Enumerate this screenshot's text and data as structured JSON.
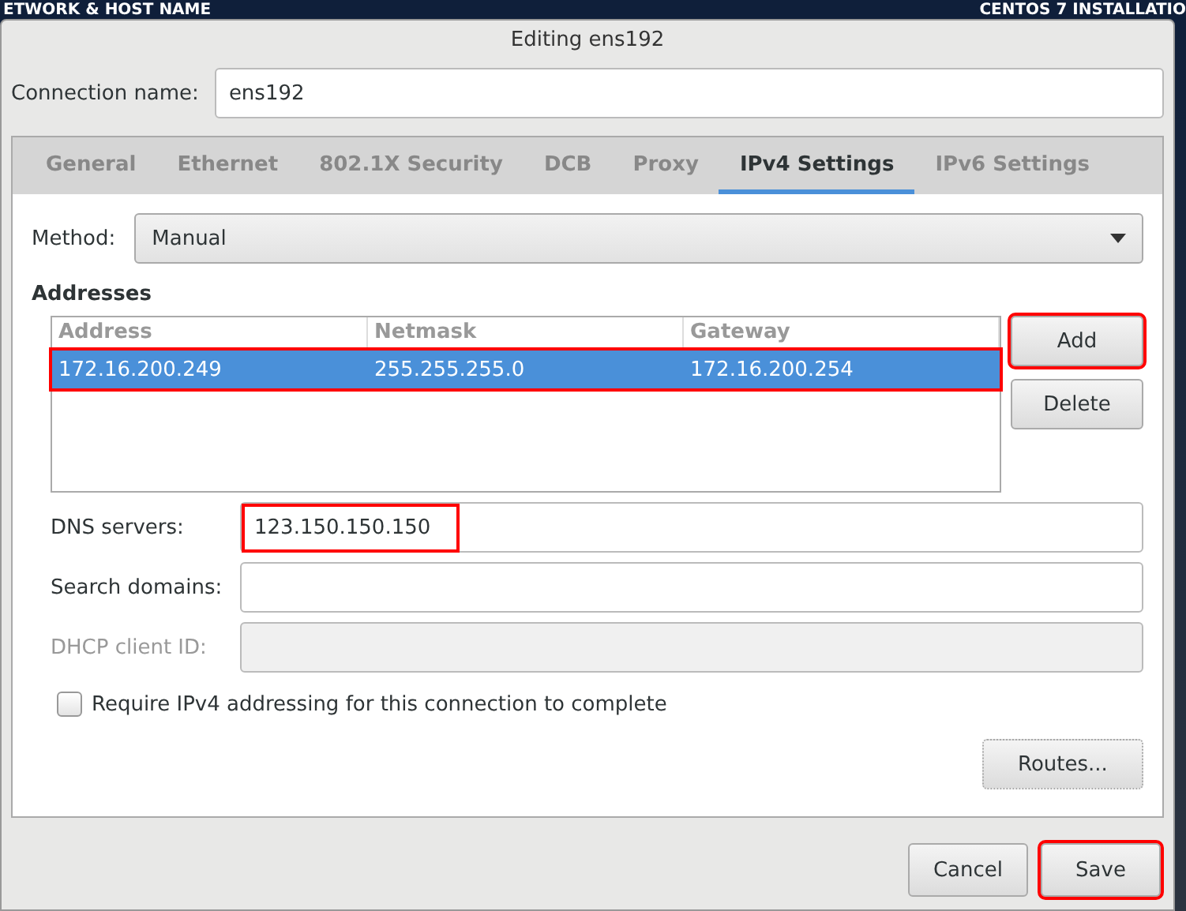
{
  "backdrop": {
    "left_title": "ETWORK & HOST NAME",
    "right_title": "CENTOS 7 INSTALLATIO"
  },
  "window": {
    "title": "Editing ens192"
  },
  "connection_name": {
    "label": "Connection name:",
    "value": "ens192"
  },
  "tabs": [
    {
      "label": "General",
      "selected": false
    },
    {
      "label": "Ethernet",
      "selected": false
    },
    {
      "label": "802.1X Security",
      "selected": false
    },
    {
      "label": "DCB",
      "selected": false
    },
    {
      "label": "Proxy",
      "selected": false
    },
    {
      "label": "IPv4 Settings",
      "selected": true
    },
    {
      "label": "IPv6 Settings",
      "selected": false
    }
  ],
  "method": {
    "label": "Method:",
    "value": "Manual"
  },
  "addresses": {
    "heading": "Addresses",
    "columns": [
      "Address",
      "Netmask",
      "Gateway"
    ],
    "rows": [
      {
        "cells": [
          "172.16.200.249",
          "255.255.255.0",
          "172.16.200.254"
        ],
        "selected": true,
        "highlighted": true
      }
    ],
    "buttons": [
      {
        "label": "Add",
        "highlighted": true
      },
      {
        "label": "Delete",
        "highlighted": false
      }
    ]
  },
  "fields": [
    {
      "label": "DNS servers:",
      "value": "123.150.150.150",
      "disabled": false,
      "highlighted": true
    },
    {
      "label": "Search domains:",
      "disabled": false
    },
    {
      "label": "DHCP client ID:",
      "disabled": true
    }
  ],
  "require_checkbox": {
    "label": "Require IPv4 addressing for this connection to complete",
    "checked": false
  },
  "routes_button": "Routes...",
  "footer_buttons": [
    {
      "label": "Cancel",
      "highlighted": false
    },
    {
      "label": "Save",
      "highlighted": true
    }
  ]
}
